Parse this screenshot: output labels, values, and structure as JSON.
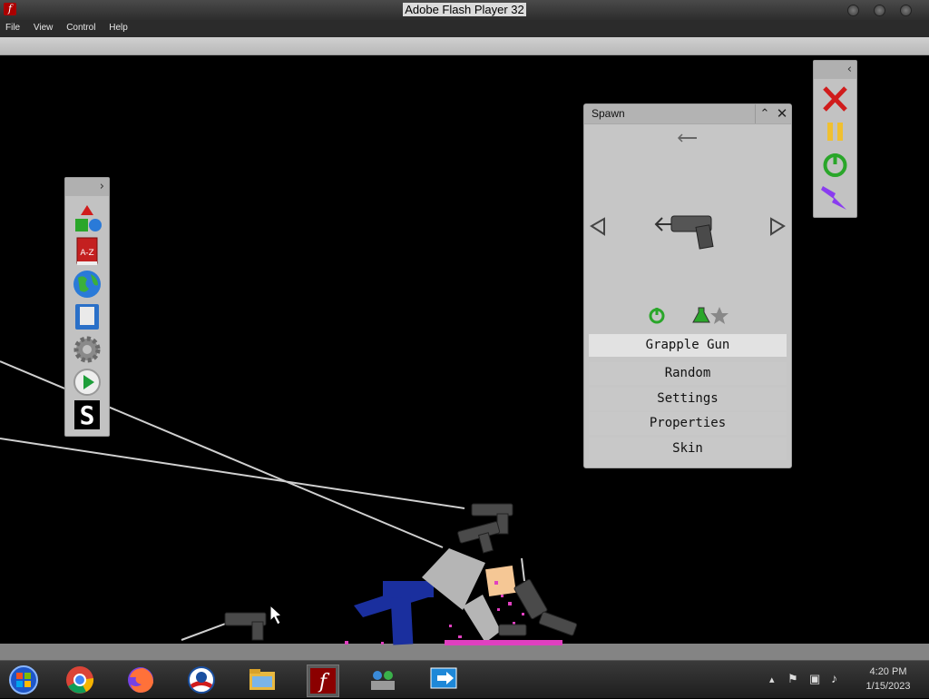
{
  "window": {
    "title": "Adobe Flash Player 32"
  },
  "menu": [
    "File",
    "View",
    "Control",
    "Help"
  ],
  "spawn_panel": {
    "title": "Spawn",
    "selected_item": "Grapple Gun",
    "items": [
      "Grapple Gun",
      "Random",
      "Settings",
      "Properties",
      "Skin"
    ]
  },
  "left_toolbar": {
    "icons": [
      "shapes-icon",
      "a-z-book-icon",
      "globe-icon",
      "save-disk-icon",
      "gear-icon",
      "play-icon",
      "s-icon"
    ],
    "a_z_label": "A-Z"
  },
  "right_toolbar": {
    "icons": [
      "close-x-icon",
      "pause-icon",
      "power-icon",
      "lightning-icon"
    ]
  },
  "taskbar": {
    "apps": [
      "windows-start-icon",
      "chrome-icon",
      "firefox-icon",
      "obama-campaign-icon",
      "file-explorer-icon",
      "flash-player-icon",
      "network-people-icon",
      "remote-desktop-icon"
    ],
    "time": "4:20 PM",
    "date": "1/15/2023"
  },
  "colors": {
    "accent_red": "#d01c1c",
    "accent_green": "#2aa62a",
    "stickman_blue": "#1a2f9e",
    "purple": "#8a3cf0"
  }
}
